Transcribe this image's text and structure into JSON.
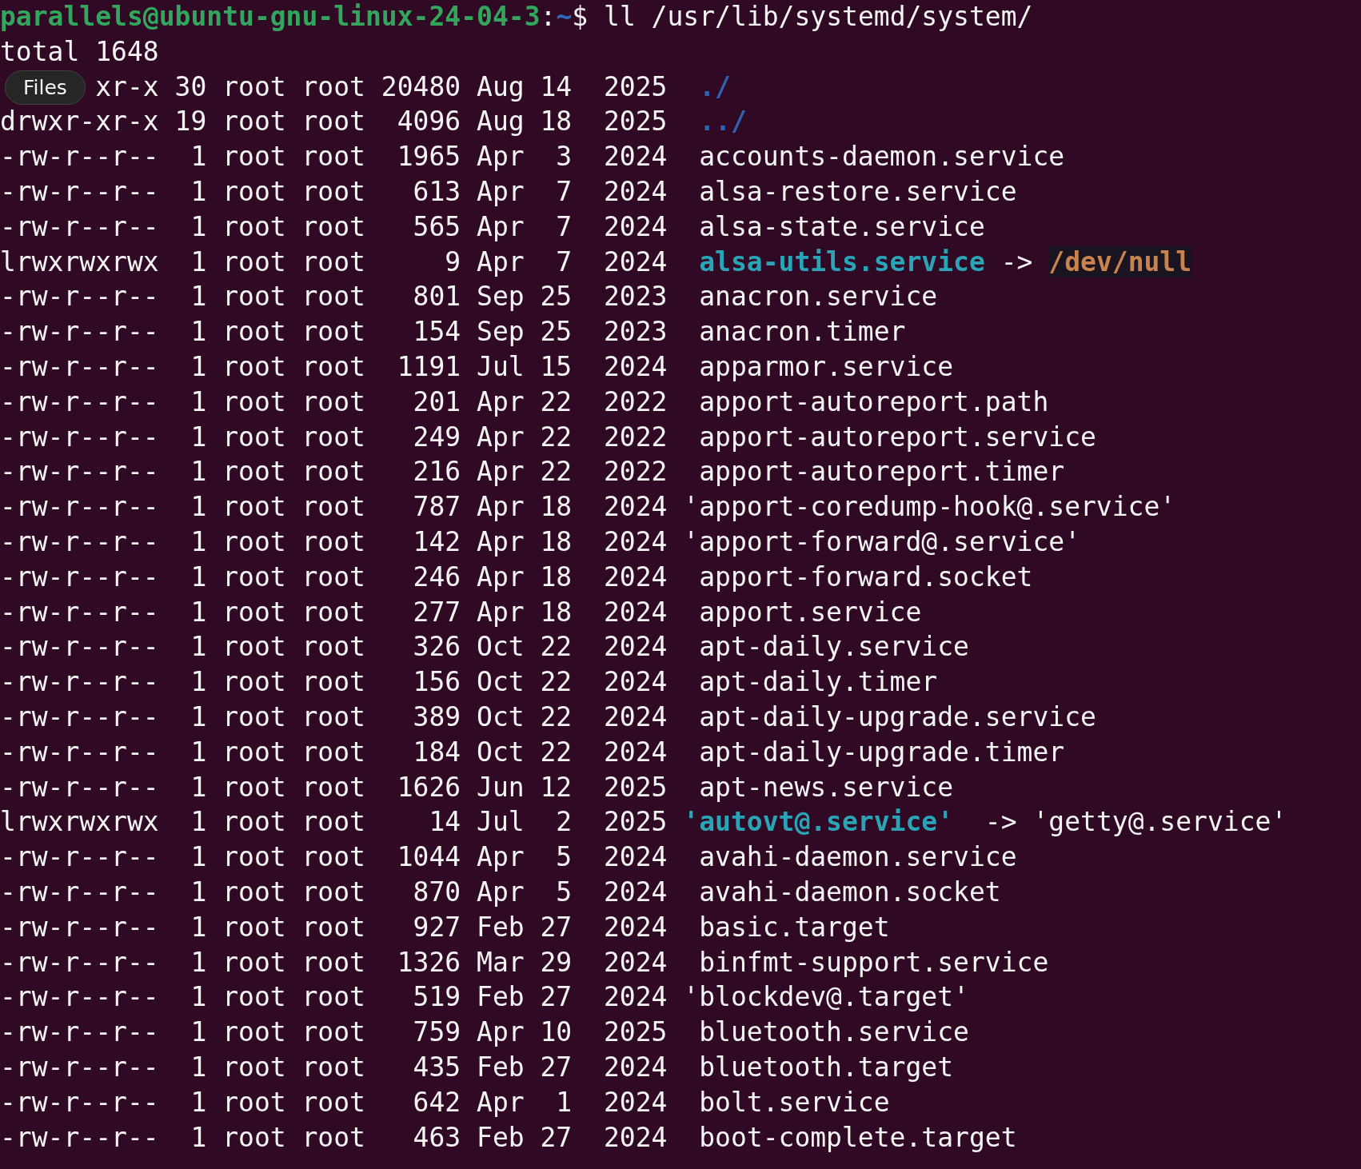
{
  "terminal": {
    "prompt": {
      "user_host": "parallels@ubuntu-gnu-linux-24-04-3",
      "separator": ":",
      "cwd": "~",
      "symbol": "$",
      "command": " ll /usr/lib/systemd/system/"
    },
    "total": "total 1648",
    "rows": [
      {
        "kind": "dir",
        "covered": true,
        "info": "xr-x 30 root root 20480 Aug 14  2025 ",
        "name": " ./"
      },
      {
        "kind": "dir",
        "info": "drwxr-xr-x 19 root root  4096 Aug 18  2025 ",
        "name": " ../"
      },
      {
        "kind": "file",
        "info": "-rw-r--r--  1 root root  1965 Apr  3  2024 ",
        "name": " accounts-daemon.service"
      },
      {
        "kind": "file",
        "info": "-rw-r--r--  1 root root   613 Apr  7  2024 ",
        "name": " alsa-restore.service"
      },
      {
        "kind": "file",
        "info": "-rw-r--r--  1 root root   565 Apr  7  2024 ",
        "name": " alsa-state.service"
      },
      {
        "kind": "link",
        "info": "lrwxrwxrwx  1 root root     9 Apr  7  2024 ",
        "name": " alsa-utils.service",
        "arrow": " -> ",
        "target": "/dev/null",
        "highlighted": true
      },
      {
        "kind": "file",
        "info": "-rw-r--r--  1 root root   801 Sep 25  2023 ",
        "name": " anacron.service"
      },
      {
        "kind": "file",
        "info": "-rw-r--r--  1 root root   154 Sep 25  2023 ",
        "name": " anacron.timer"
      },
      {
        "kind": "file",
        "info": "-rw-r--r--  1 root root  1191 Jul 15  2024 ",
        "name": " apparmor.service"
      },
      {
        "kind": "file",
        "info": "-rw-r--r--  1 root root   201 Apr 22  2022 ",
        "name": " apport-autoreport.path"
      },
      {
        "kind": "file",
        "info": "-rw-r--r--  1 root root   249 Apr 22  2022 ",
        "name": " apport-autoreport.service"
      },
      {
        "kind": "file",
        "info": "-rw-r--r--  1 root root   216 Apr 22  2022 ",
        "name": " apport-autoreport.timer"
      },
      {
        "kind": "file",
        "info": "-rw-r--r--  1 root root   787 Apr 18  2024 ",
        "name": "'apport-coredump-hook@.service'"
      },
      {
        "kind": "file",
        "info": "-rw-r--r--  1 root root   142 Apr 18  2024 ",
        "name": "'apport-forward@.service'"
      },
      {
        "kind": "file",
        "info": "-rw-r--r--  1 root root   246 Apr 18  2024 ",
        "name": " apport-forward.socket"
      },
      {
        "kind": "file",
        "info": "-rw-r--r--  1 root root   277 Apr 18  2024 ",
        "name": " apport.service"
      },
      {
        "kind": "file",
        "info": "-rw-r--r--  1 root root   326 Oct 22  2024 ",
        "name": " apt-daily.service"
      },
      {
        "kind": "file",
        "info": "-rw-r--r--  1 root root   156 Oct 22  2024 ",
        "name": " apt-daily.timer"
      },
      {
        "kind": "file",
        "info": "-rw-r--r--  1 root root   389 Oct 22  2024 ",
        "name": " apt-daily-upgrade.service"
      },
      {
        "kind": "file",
        "info": "-rw-r--r--  1 root root   184 Oct 22  2024 ",
        "name": " apt-daily-upgrade.timer"
      },
      {
        "kind": "file",
        "info": "-rw-r--r--  1 root root  1626 Jun 12  2025 ",
        "name": " apt-news.service"
      },
      {
        "kind": "link",
        "info": "lrwxrwxrwx  1 root root    14 Jul  2  2025 ",
        "name": "'autovt@.service'",
        "arrow": "  -> ",
        "target": "'getty@.service'",
        "highlighted": false
      },
      {
        "kind": "file",
        "info": "-rw-r--r--  1 root root  1044 Apr  5  2024 ",
        "name": " avahi-daemon.service"
      },
      {
        "kind": "file",
        "info": "-rw-r--r--  1 root root   870 Apr  5  2024 ",
        "name": " avahi-daemon.socket"
      },
      {
        "kind": "file",
        "info": "-rw-r--r--  1 root root   927 Feb 27  2024 ",
        "name": " basic.target"
      },
      {
        "kind": "file",
        "info": "-rw-r--r--  1 root root  1326 Mar 29  2024 ",
        "name": " binfmt-support.service"
      },
      {
        "kind": "file",
        "info": "-rw-r--r--  1 root root   519 Feb 27  2024 ",
        "name": "'blockdev@.target'"
      },
      {
        "kind": "file",
        "info": "-rw-r--r--  1 root root   759 Apr 10  2025 ",
        "name": " bluetooth.service"
      },
      {
        "kind": "file",
        "info": "-rw-r--r--  1 root root   435 Feb 27  2024 ",
        "name": " bluetooth.target"
      },
      {
        "kind": "file",
        "info": "-rw-r--r--  1 root root   642 Apr  1  2024 ",
        "name": " bolt.service"
      },
      {
        "kind": "file",
        "info": "-rw-r--r--  1 root root   463 Feb 27  2024 ",
        "name": " boot-complete.target"
      }
    ]
  },
  "tooltip": {
    "label": "Files"
  }
}
